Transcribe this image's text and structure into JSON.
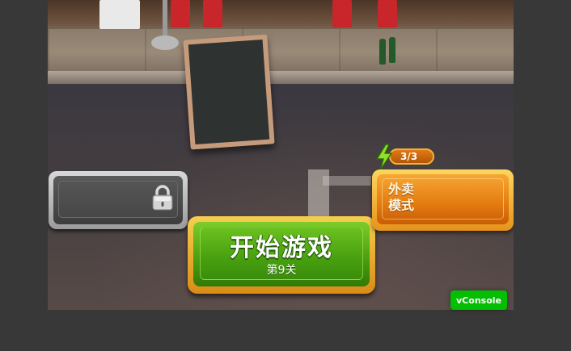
{
  "start_button": {
    "title": "开始游戏",
    "level": "第9关"
  },
  "energy": {
    "value": "3/3",
    "icon": "lightning-bolt-icon"
  },
  "takeout_button": {
    "label": "外卖模式",
    "label_line1": "外卖",
    "label_line2": "模式"
  },
  "locked_button": {
    "icon": "padlock-icon"
  },
  "vconsole": {
    "label": "vConsole"
  },
  "colors": {
    "start_green": "#4fa012",
    "takeout_orange": "#e37b11",
    "locked_gray": "#474747",
    "vconsole_green": "#04be02",
    "frame_background": "#383838"
  }
}
